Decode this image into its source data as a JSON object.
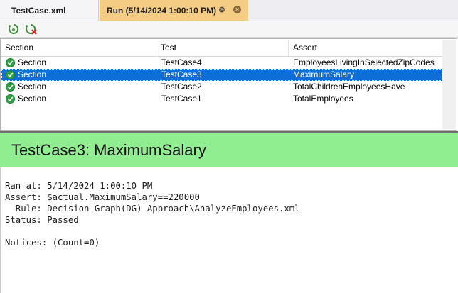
{
  "tabs": {
    "doc_tab": "TestCase.xml",
    "run_tab": "Run (5/14/2024 1:00:10 PM)"
  },
  "toolbar": {
    "icons": [
      "run-tests-icon",
      "stop-tests-icon"
    ]
  },
  "grid": {
    "columns": [
      "Section",
      "Test",
      "Assert"
    ],
    "rows": [
      {
        "section": "Section",
        "test": "TestCase4",
        "assert": "EmployeesLivingInSelectedZipCodes",
        "status": "passed"
      },
      {
        "section": "Section",
        "test": "TestCase3",
        "assert": "MaximumSalary",
        "status": "passed",
        "selected": true
      },
      {
        "section": "Section",
        "test": "TestCase2",
        "assert": "TotalChildrenEmployeesHave",
        "status": "passed"
      },
      {
        "section": "Section",
        "test": "TestCase1",
        "assert": "TotalEmployees",
        "status": "passed"
      }
    ]
  },
  "detail": {
    "title": "TestCase3: MaximumSalary",
    "title_color": "#90ee90",
    "ran_at": "Ran at: 5/14/2024 1:00:10 PM",
    "assert": "Assert: $actual.MaximumSalary==220000",
    "rule": "  Rule: Decision Graph(DG) Approach\\AnalyzeEmployees.xml",
    "status": "Status: Passed",
    "notices": "Notices: (Count=0)"
  },
  "colors": {
    "selection": "#0e6ed8",
    "run_tab": "#f5cc84",
    "pass_green": "#2ea043"
  }
}
